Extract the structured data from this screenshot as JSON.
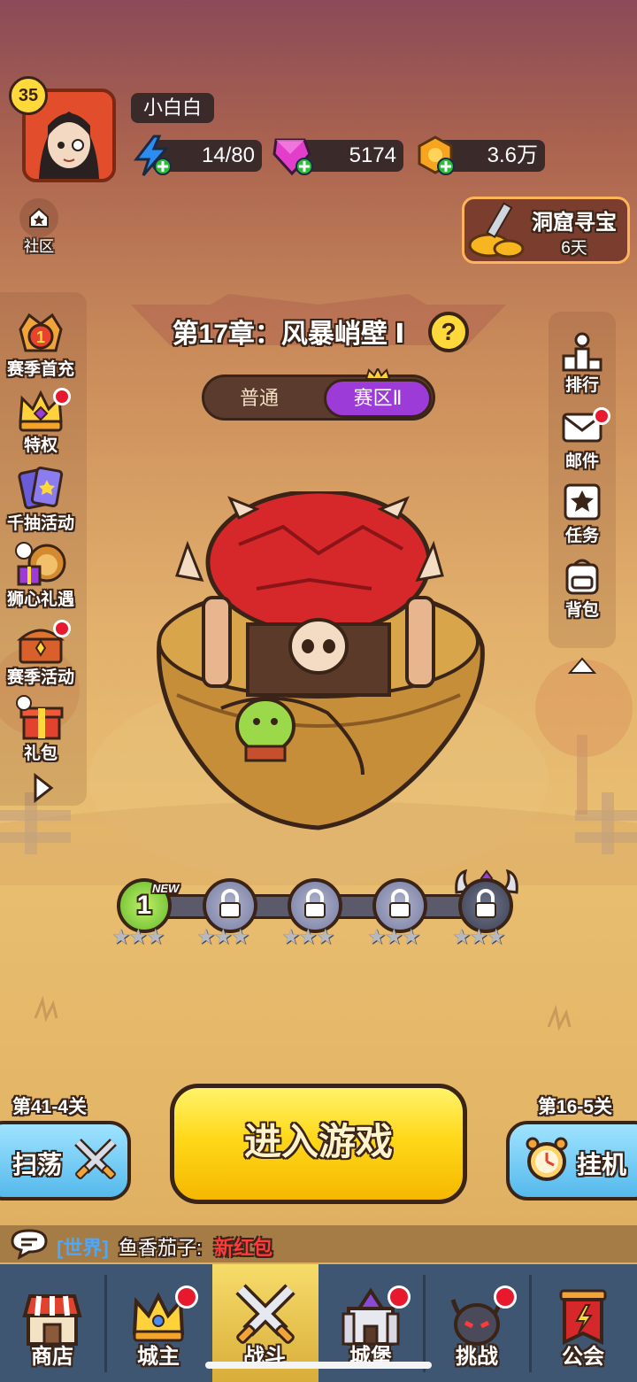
{
  "player": {
    "level": "35",
    "name": "小白白"
  },
  "resources": {
    "energy": "14/80",
    "gems": "5174",
    "gold": "3.6万"
  },
  "community": {
    "label": "社区"
  },
  "treasure_event": {
    "title": "洞窟寻宝",
    "days": "6天"
  },
  "left_menu": [
    {
      "label": "赛季首充",
      "icon": "season-first-charge-icon",
      "badge": false
    },
    {
      "label": "特权",
      "icon": "crown-privilege-icon",
      "badge": true
    },
    {
      "label": "千抽活动",
      "icon": "cards-draw-icon",
      "badge": false
    },
    {
      "label": "狮心礼遇",
      "icon": "lion-gift-icon",
      "badge": false
    },
    {
      "label": "赛季活动",
      "icon": "treasure-chest-icon",
      "badge": true
    },
    {
      "label": "礼包",
      "icon": "gift-box-icon",
      "badge": false
    }
  ],
  "right_menu": [
    {
      "label": "排行",
      "icon": "ranking-icon",
      "badge": false
    },
    {
      "label": "邮件",
      "icon": "mail-icon",
      "badge": true
    },
    {
      "label": "任务",
      "icon": "quest-icon",
      "badge": false
    },
    {
      "label": "背包",
      "icon": "backpack-icon",
      "badge": false
    }
  ],
  "chapter": {
    "title": "第17章：风暴峭壁 Ⅰ",
    "help": "?"
  },
  "mode_toggle": {
    "normal": "普通",
    "zone": "赛区Ⅱ"
  },
  "stages": [
    {
      "label": "1",
      "state": "unlocked",
      "new_tag": "NEW"
    },
    {
      "label": "",
      "state": "locked"
    },
    {
      "label": "",
      "state": "locked"
    },
    {
      "label": "",
      "state": "locked"
    },
    {
      "label": "",
      "state": "boss-locked"
    }
  ],
  "sweep": {
    "stage": "第41-4关",
    "label": "扫荡"
  },
  "enter_game": {
    "label": "进入游戏"
  },
  "idle": {
    "stage": "第16-5关",
    "label": "挂机"
  },
  "chat": {
    "channel": "[世界]",
    "sender": "鱼香茄子:",
    "message": "新红包"
  },
  "nav": [
    {
      "label": "商店",
      "icon": "shop-icon",
      "badge": false,
      "active": false
    },
    {
      "label": "城主",
      "icon": "lord-crown-icon",
      "badge": true,
      "active": false
    },
    {
      "label": "战斗",
      "icon": "crossed-swords-icon",
      "badge": false,
      "active": true
    },
    {
      "label": "城堡",
      "icon": "castle-icon",
      "badge": true,
      "active": false
    },
    {
      "label": "挑战",
      "icon": "demon-helmet-icon",
      "badge": true,
      "active": false
    },
    {
      "label": "公会",
      "icon": "guild-banner-icon",
      "badge": false,
      "active": false
    }
  ],
  "colors": {
    "accent_purple": "#9c3bd8",
    "enter_yellow": "#ffd81a",
    "badge_red": "#e8192c",
    "nav_bg": "#3e5671",
    "active_tab": "#e6c24d"
  }
}
